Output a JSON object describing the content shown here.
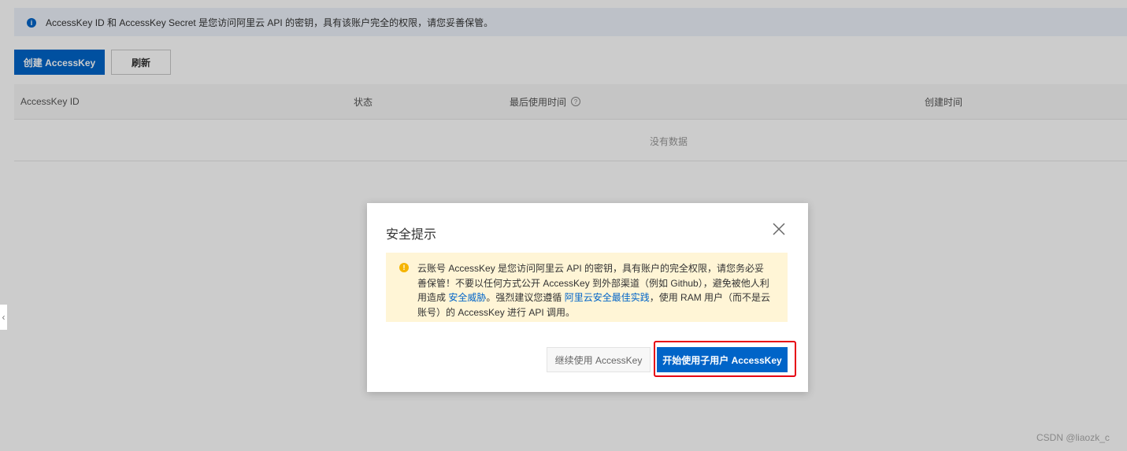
{
  "notice": {
    "text": "AccessKey ID 和 AccessKey Secret 是您访问阿里云 API 的密钥，具有该账户完全的权限，请您妥善保管。"
  },
  "toolbar": {
    "create_label": "创建 AccessKey",
    "refresh_label": "刷新"
  },
  "table": {
    "columns": [
      "AccessKey ID",
      "状态",
      "最后使用时间",
      "创建时间"
    ],
    "empty_text": "没有数据"
  },
  "dialog": {
    "title": "安全提示",
    "warning": {
      "part1": "云账号 AccessKey 是您访问阿里云 API 的密钥，具有账户的完全权限，请您务必妥善保管！不要以任何方式公开 AccessKey 到外部渠道（例如 Github），避免被他人利用造成 ",
      "link1": "安全威胁",
      "part2": "。强烈建议您遵循 ",
      "link2": "阿里云安全最佳实践",
      "part3": "，使用 RAM 用户（而不是云账号）的 AccessKey 进行 API 调用。"
    },
    "continue_label": "继续使用 AccessKey",
    "start_label": "开始使用子用户 AccessKey"
  },
  "watermark": "CSDN @liaozk_c",
  "colors": {
    "primary": "#0064c8",
    "warning_bg": "#fff5d6",
    "highlight": "#e60012"
  }
}
